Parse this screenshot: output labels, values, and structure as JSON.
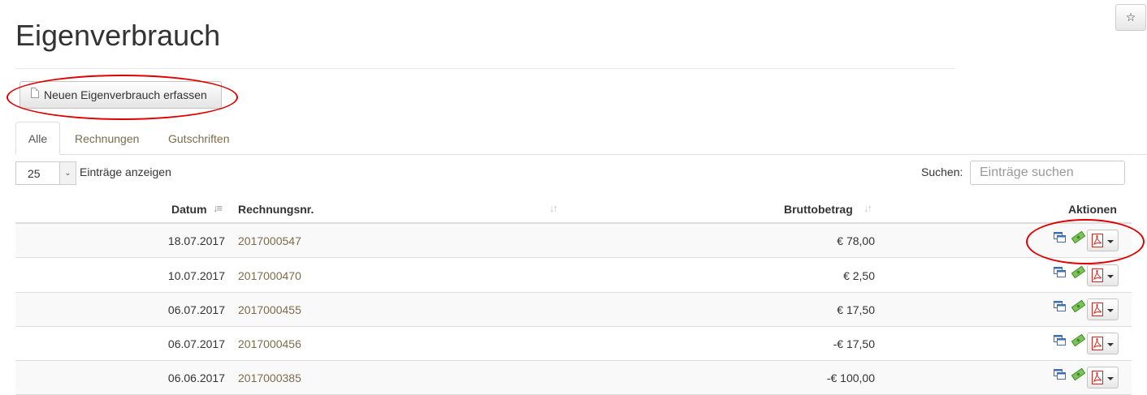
{
  "page": {
    "title": "Eigenverbrauch",
    "star": "☆"
  },
  "toolbar": {
    "new_label": "Neuen Eigenverbrauch erfassen"
  },
  "tabs": [
    {
      "label": "Alle",
      "active": true
    },
    {
      "label": "Rechnungen",
      "active": false
    },
    {
      "label": "Gutschriften",
      "active": false
    }
  ],
  "length": {
    "value": "25",
    "label": "Einträge anzeigen"
  },
  "search": {
    "label": "Suchen:",
    "placeholder": "Einträge suchen"
  },
  "table": {
    "headers": {
      "date": "Datum",
      "number": "Rechnungsnr.",
      "amount": "Bruttobetrag",
      "actions": "Aktionen"
    },
    "rows": [
      {
        "date": "18.07.2017",
        "number": "2017000547",
        "amount": "€ 78,00"
      },
      {
        "date": "10.07.2017",
        "number": "2017000470",
        "amount": "€ 2,50"
      },
      {
        "date": "06.07.2017",
        "number": "2017000455",
        "amount": "€ 17,50"
      },
      {
        "date": "06.07.2017",
        "number": "2017000456",
        "amount": "-€ 17,50"
      },
      {
        "date": "06.06.2017",
        "number": "2017000385",
        "amount": "-€ 100,00"
      }
    ]
  },
  "colors": {
    "link": "#7d6b4b",
    "annotation": "#e00000",
    "pdf": "#d9251c",
    "money": "#5ba53a",
    "copy": "#3a6fb3"
  },
  "icons": {
    "row_actions": [
      "copy-icon",
      "money-icon",
      "pdf-icon",
      "caret-down-icon"
    ],
    "new_button": "document-icon",
    "sort": "sort-icon"
  }
}
